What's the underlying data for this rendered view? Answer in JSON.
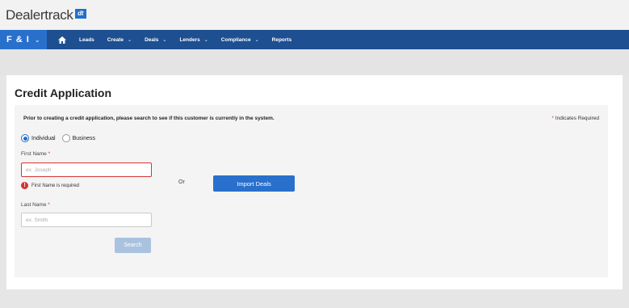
{
  "brand": {
    "name": "Dealertrack",
    "badge": "dt"
  },
  "nav": {
    "module": "F & I",
    "items": [
      {
        "label": "Leads",
        "dropdown": false
      },
      {
        "label": "Create",
        "dropdown": true
      },
      {
        "label": "Deals",
        "dropdown": true
      },
      {
        "label": "Lenders",
        "dropdown": true
      },
      {
        "label": "Compliance",
        "dropdown": true
      },
      {
        "label": "Reports",
        "dropdown": false
      }
    ]
  },
  "page": {
    "title": "Credit Application",
    "instructions": "Prior to creating a credit application, please search to see if this customer is currently in the system.",
    "required_star": "*",
    "required_note": "Indicates Required"
  },
  "form": {
    "customer_type": {
      "options": [
        "Individual",
        "Business"
      ],
      "selected": "Individual"
    },
    "first_name": {
      "label": "First Name",
      "placeholder": "ex. Joseph",
      "value": "",
      "error": "First Name is required"
    },
    "last_name": {
      "label": "Last Name",
      "placeholder": "ex. Smith",
      "value": ""
    },
    "or_text": "Or",
    "import_button": "Import Deals",
    "search_button": "Search"
  },
  "colors": {
    "nav_bg": "#1d4f91",
    "accent": "#2970cc",
    "error": "#d63333",
    "search_disabled": "#a9c3df"
  }
}
